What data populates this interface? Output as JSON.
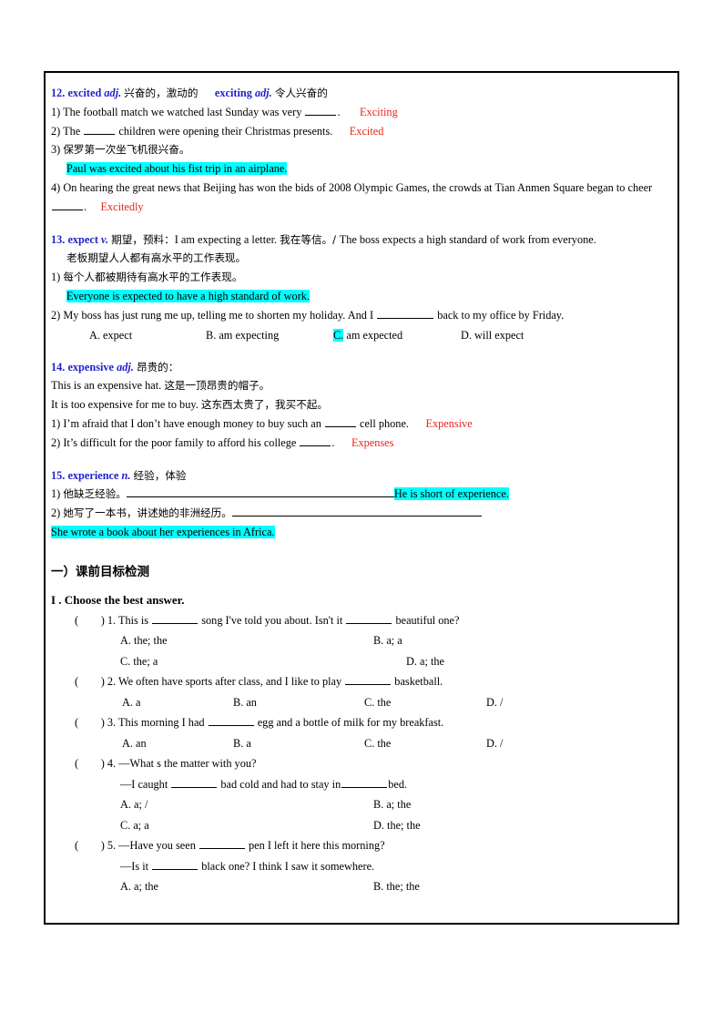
{
  "document": {
    "entries": [
      {
        "number": "12.",
        "word": "excited",
        "pos": "adj.",
        "cn_gloss": "兴奋的，激动的",
        "word2": "exciting",
        "pos2": "adj.",
        "cn_gloss2": "令人兴奋的",
        "items": [
          {
            "marker": "1)",
            "text_before": "The football match we watched last Sunday was very ",
            "text_after": ".",
            "answer": "Exciting"
          },
          {
            "marker": "2)",
            "text_before": "The ",
            "text_after": " children were opening their Christmas presents.",
            "answer": "Excited"
          },
          {
            "marker": "3)",
            "prompt_cn": "保罗第一次坐飞机很兴奋。",
            "highlighted": "Paul was excited about his fist trip in an airplane."
          },
          {
            "marker": "4)",
            "text_before": "On hearing the great news that Beijing has won the bids of 2008 Olympic Games, the crowds at Tian Anmen Square began to cheer ",
            "text_after": ".",
            "answer": "Excitedly"
          }
        ]
      },
      {
        "number": "13.",
        "word": "expect",
        "pos": "v.",
        "cn_gloss": "期望，预料：",
        "example_en1": "I am expecting a letter.",
        "example_cn1": "我在等信。/ ",
        "example_en2": "The boss expects a high standard of work from everyone.",
        "example_cn2": "老板期望人人都有高水平的工作表现。",
        "items": [
          {
            "marker": "1)",
            "prompt_cn": "每个人都被期待有高水平的工作表现。",
            "highlighted": "Everyone is expected to have a high standard of work."
          },
          {
            "marker": "2)",
            "text_before": "My boss has just rung me up, telling me to shorten my holiday. And I ",
            "text_after": " back to my office by Friday.",
            "options": [
              {
                "label": "A. expect",
                "highlighted_prefix": ""
              },
              {
                "label": "B. am expecting",
                "highlighted_prefix": ""
              },
              {
                "label": "am expected",
                "highlighted_prefix": "C."
              },
              {
                "label": "D. will expect",
                "highlighted_prefix": ""
              }
            ]
          }
        ]
      },
      {
        "number": "14.",
        "word": "expensive",
        "pos": "adj.",
        "cn_gloss": "昂贵的：",
        "example_en1": "This is an expensive hat.",
        "example_cn1": "这是一顶昂贵的帽子。",
        "example_en2": "It is too expensive for me to buy.",
        "example_cn2": "这东西太贵了，我买不起。",
        "items": [
          {
            "marker": "1)",
            "text_before": "I’m afraid that I don’t have enough money to buy such an ",
            "text_after": " cell phone.",
            "answer": "Expensive"
          },
          {
            "marker": "2)",
            "text_before": "It’s difficult for the poor family to afford his college ",
            "text_after": ".",
            "answer": "Expenses"
          }
        ]
      },
      {
        "number": "15.",
        "word": "experience",
        "pos": "n.",
        "cn_gloss": "经验，体验",
        "items": [
          {
            "marker": "1)",
            "prompt_cn": "他缺乏经验。",
            "highlighted": "He is short of experience."
          },
          {
            "marker": "2)",
            "prompt_cn": "她写了一本书，讲述她的非洲经历。",
            "highlighted": "She wrote a book about her experiences in Africa."
          }
        ]
      }
    ],
    "section": {
      "title": "一）课前目标检测",
      "part_title": "I . Choose the best answer.",
      "questions": [
        {
          "bracket": "(        ) ",
          "number": "1.",
          "stem_a": "This is ",
          "stem_b": " song I've told you about. Isn't it ",
          "stem_c": " beautiful one?",
          "layout": "two-column",
          "options": [
            "A. the; the",
            "B. a; a",
            "C. the; a",
            "D. a; the"
          ]
        },
        {
          "bracket": "(        ) ",
          "number": "2.",
          "stem_a": "We often have sports after class, and I like to play ",
          "stem_b": " basketball.",
          "layout": "four-column",
          "options": [
            "A. a",
            "B. an",
            "C. the",
            "D. /"
          ]
        },
        {
          "bracket": "(        ) ",
          "number": "3.",
          "stem_a": "This morning I had ",
          "stem_b": " egg and a bottle of milk for my breakfast.",
          "layout": "four-column",
          "options": [
            "A. an",
            "B. a",
            "C. the",
            "D. /"
          ]
        },
        {
          "bracket": "(        ) ",
          "number": "4.",
          "stem_a": "—What s the matter with you?",
          "stem_line2_a": "—I caught ",
          "stem_line2_b": " bad cold and had to stay in",
          "stem_line2_c": "bed.",
          "layout": "two-column",
          "options": [
            "A. a; /",
            "B. a; the",
            "C. a; a",
            "D. the; the"
          ]
        },
        {
          "bracket": "(        ) ",
          "number": "5.",
          "stem_a": "—Have you seen ",
          "stem_b": " pen I left it here this morning?",
          "stem_line2_a": "—Is it ",
          "stem_line2_b": " black one? I think I saw it somewhere.",
          "layout": "two-column-partial",
          "options": [
            "A. a; the",
            "B. the; the"
          ]
        }
      ]
    }
  },
  "colors": {
    "heading_blue": "#2222cc",
    "answer_red": "#e8251b",
    "highlight_cyan": "#00ffff",
    "border_black": "#000000"
  }
}
